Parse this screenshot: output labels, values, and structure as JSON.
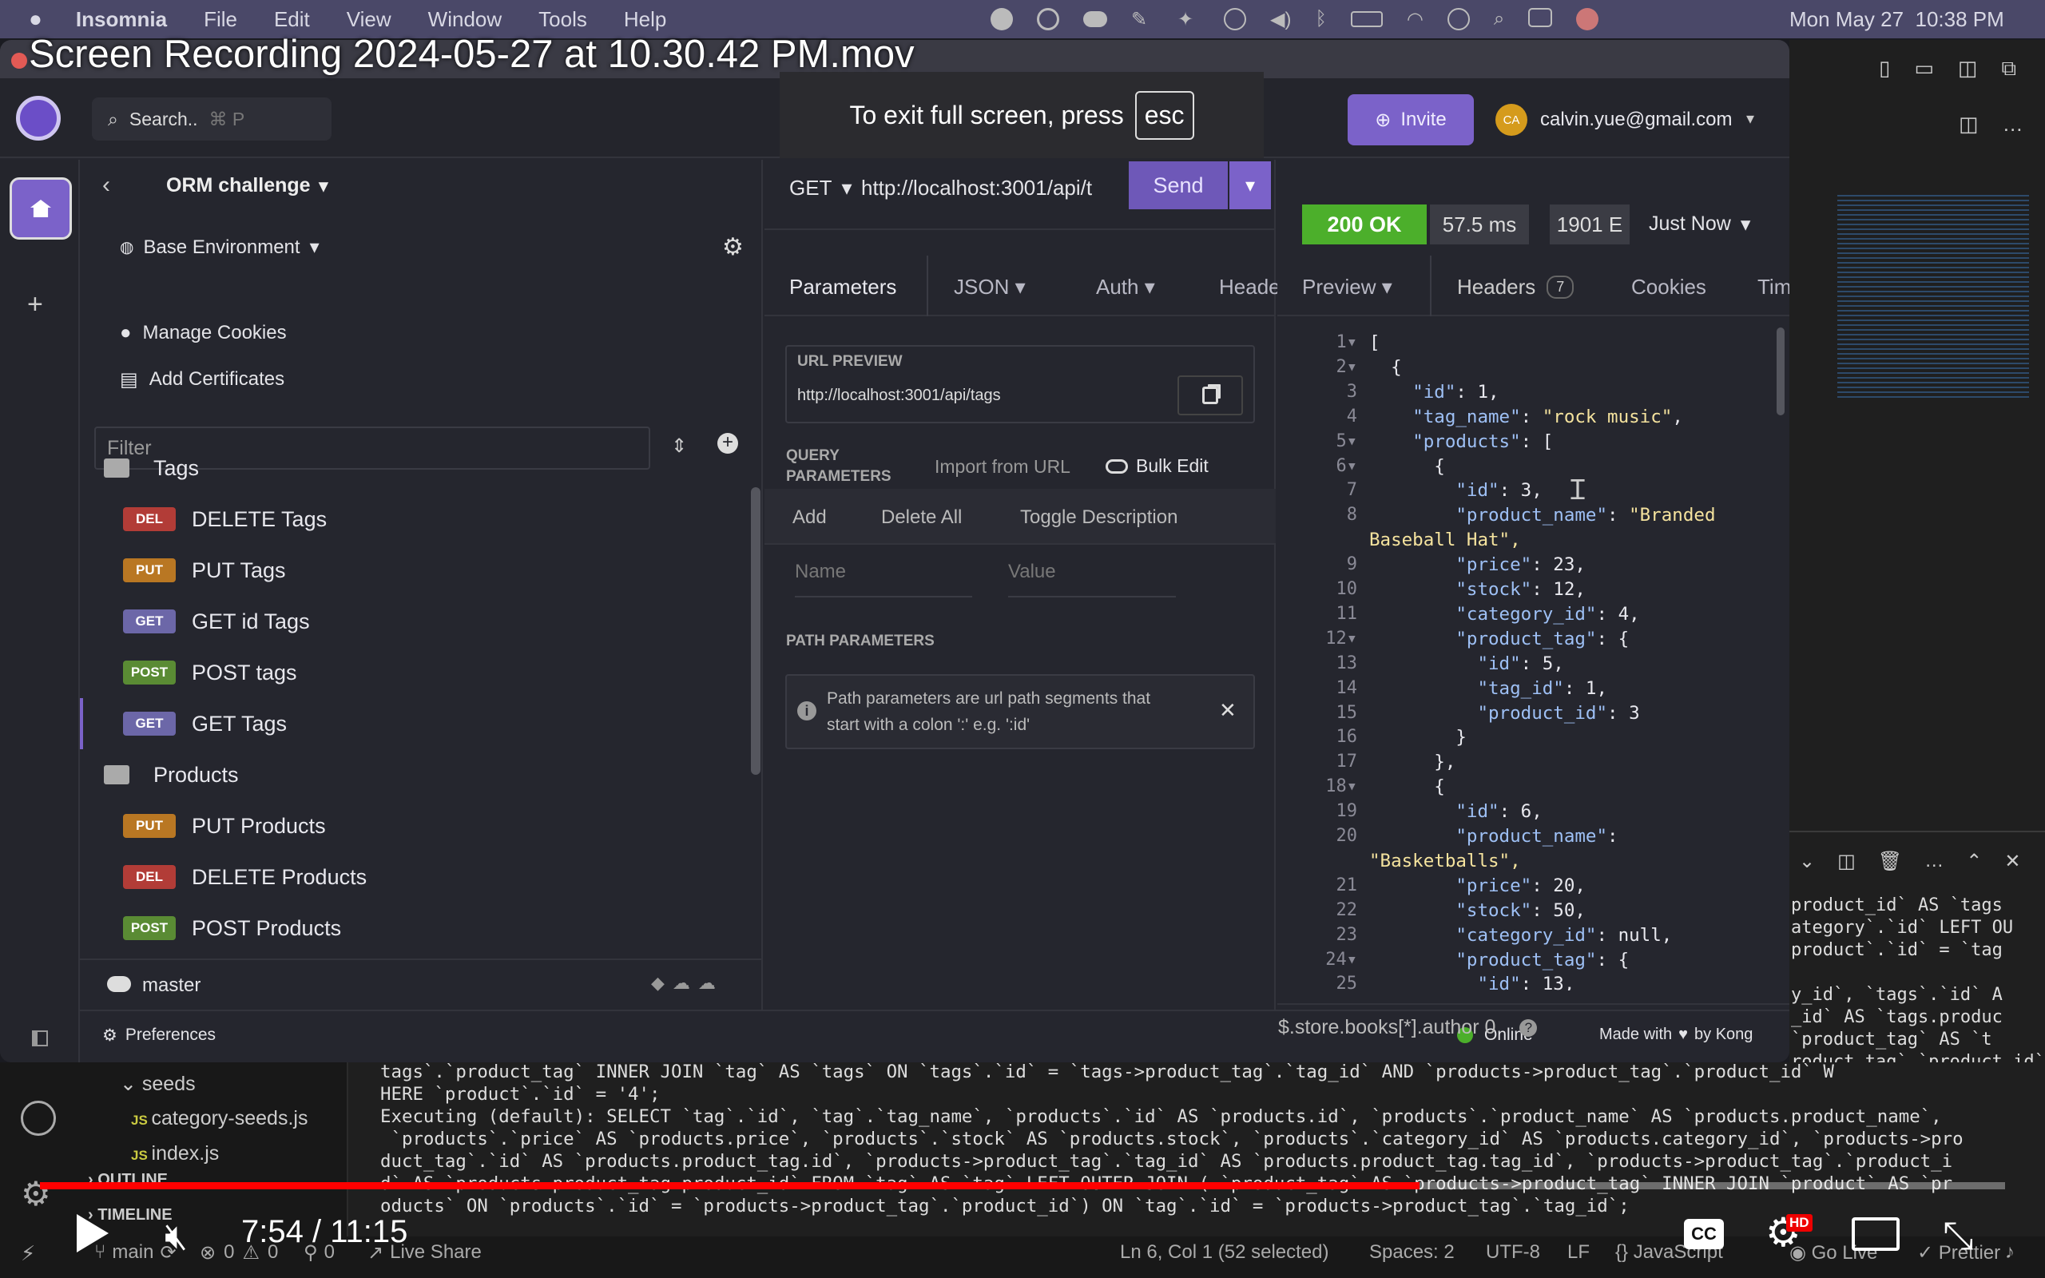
{
  "menubar": {
    "app": "Insomnia",
    "items": [
      "File",
      "Edit",
      "View",
      "Window",
      "Tools",
      "Help"
    ],
    "clock": "Mon May 27  10:38 PM"
  },
  "video": {
    "title": "Screen Recording 2024-05-27 at 10.30.42 PM.mov",
    "fullscreen_hint": "To exit full screen, press",
    "esc_key": "esc",
    "time": "7:54 / 11:15",
    "progress": 0.702
  },
  "topbar": {
    "search_placeholder": "Search..",
    "search_shortcut": "⌘ P",
    "invite": "Invite",
    "avatar_initials": "CA",
    "user": "calvin.yue@gmail.com"
  },
  "project": {
    "name": "ORM challenge",
    "env": "Base Environment",
    "manage_cookies": "Manage Cookies",
    "add_certificates": "Add Certificates",
    "filter_placeholder": "Filter"
  },
  "tree": {
    "folder1": "Tags",
    "tags": [
      {
        "m": "DEL",
        "label": "DELETE Tags"
      },
      {
        "m": "PUT",
        "label": "PUT Tags"
      },
      {
        "m": "GET",
        "label": "GET id Tags"
      },
      {
        "m": "POST",
        "label": "POST tags"
      },
      {
        "m": "GET",
        "label": "GET Tags"
      }
    ],
    "folder2": "Products",
    "products": [
      {
        "m": "PUT",
        "label": "PUT Products"
      },
      {
        "m": "DEL",
        "label": "DELETE Products"
      },
      {
        "m": "POST",
        "label": "POST Products"
      }
    ]
  },
  "footer": {
    "branch": "master",
    "preferences": "Preferences",
    "status": "Online",
    "made_with": "Made with",
    "by": "by Kong"
  },
  "request": {
    "method": "GET",
    "url": "http://localhost:3001/api/t",
    "send": "Send",
    "tabs": [
      "Parameters",
      "JSON",
      "Auth",
      "Heade"
    ],
    "url_preview_label": "URL PREVIEW",
    "url_preview": "http://localhost:3001/api/tags",
    "query_label_1": "QUERY",
    "query_label_2": "PARAMETERS",
    "import_url": "Import from URL",
    "bulk_edit": "Bulk Edit",
    "add": "Add",
    "delete_all": "Delete All",
    "toggle_desc": "Toggle Description",
    "name_placeholder": "Name",
    "value_placeholder": "Value",
    "path_label": "PATH PARAMETERS",
    "path_info_1": "Path parameters are url path segments that",
    "path_info_2": "start with a colon ':' e.g. ':id'"
  },
  "response": {
    "status": "200 OK",
    "time": "57.5 ms",
    "size": "1901 E",
    "when": "Just Now",
    "tabs": [
      "Preview",
      "Headers",
      "Cookies",
      "Tim"
    ],
    "headers_count": "7",
    "filter": "$.store.books[*].author 0"
  },
  "json_lines": [
    {
      "n": "1",
      "t": "["
    },
    {
      "n": "2",
      "t": "  {"
    },
    {
      "n": "3",
      "t": "    \"id\": 1,"
    },
    {
      "n": "4",
      "t": "    \"tag_name\": \"rock music\","
    },
    {
      "n": "5",
      "t": "    \"products\": ["
    },
    {
      "n": "6",
      "t": "      {"
    },
    {
      "n": "7",
      "t": "        \"id\": 3,"
    },
    {
      "n": "8",
      "t": "        \"product_name\": \"Branded"
    },
    {
      "n": "",
      "t": "Baseball Hat\","
    },
    {
      "n": "9",
      "t": "        \"price\": 23,"
    },
    {
      "n": "10",
      "t": "        \"stock\": 12,"
    },
    {
      "n": "11",
      "t": "        \"category_id\": 4,"
    },
    {
      "n": "12",
      "t": "        \"product_tag\": {"
    },
    {
      "n": "13",
      "t": "          \"id\": 5,"
    },
    {
      "n": "14",
      "t": "          \"tag_id\": 1,"
    },
    {
      "n": "15",
      "t": "          \"product_id\": 3"
    },
    {
      "n": "16",
      "t": "        }"
    },
    {
      "n": "17",
      "t": "      },"
    },
    {
      "n": "18",
      "t": "      {"
    },
    {
      "n": "19",
      "t": "        \"id\": 6,"
    },
    {
      "n": "20",
      "t": "        \"product_name\":"
    },
    {
      "n": "",
      "t": "\"Basketballs\","
    },
    {
      "n": "21",
      "t": "        \"price\": 20,"
    },
    {
      "n": "22",
      "t": "        \"stock\": 50,"
    },
    {
      "n": "23",
      "t": "        \"category_id\": null,"
    },
    {
      "n": "24",
      "t": "        \"product_tag\": {"
    },
    {
      "n": "25",
      "t": "          \"id\": 13,"
    }
  ],
  "vscode": {
    "explorer": [
      "seeds",
      "category-seeds.js",
      "index.js",
      "OUTLINE",
      "TIMELINE"
    ],
    "terminal_lines": [
      "tags`.`product_tag` INNER JOIN `tag` AS `tags` ON `tags`.`id` = `tags->product_tag`.`tag_id` AND `products->product_tag`.`product_id` W",
      "HERE `product`.`id` = '4';",
      "Executing (default): SELECT `tag`.`id`, `tag`.`tag_name`, `products`.`id` AS `products.id`, `products`.`product_name` AS `products.product_name`,",
      " `products`.`price` AS `products.price`, `products`.`stock` AS `products.stock`, `products`.`category_id` AS `products.category_id`, `products->pro",
      "duct_tag`.`id` AS `products.product_tag.id`, `products->product_tag`.`tag_id` AS `products.product_tag.tag_id`, `products->product_tag`.`product_i",
      "d` AS `products.product_tag.product_id` FROM `tag` AS `tag` LEFT OUTER JOIN ( `product_tag` AS `products->product_tag` INNER JOIN `product` AS `pr",
      "oducts` ON `products`.`id` = `products->product_tag`.`product_id`) ON `tag`.`id` = `products->product_tag`.`tag_id`;"
    ],
    "right_term": [
      "product_id` AS `tags",
      "ategory`.`id` LEFT OU",
      "product`.`id` = `tag",
      "",
      "y_id`, `tags`.`id` A",
      "_id` AS `tags.produc",
      "`product_tag` AS `t",
      "roduct_tag`.`product_id` W"
    ],
    "status": {
      "branch": "main",
      "errors": "0",
      "warnings": "0",
      "ports": "0",
      "live_share": "Live Share",
      "pos": "Ln 6, Col 1 (52 selected)",
      "spaces": "Spaces: 2",
      "enc": "UTF-8",
      "eol": "LF",
      "lang": "JavaScript",
      "golive": "Go Live",
      "prettier": "Prettier"
    }
  },
  "colors": {
    "accent": "#7b62c9",
    "ok": "#4caf2b",
    "progress": "#ff0000"
  }
}
